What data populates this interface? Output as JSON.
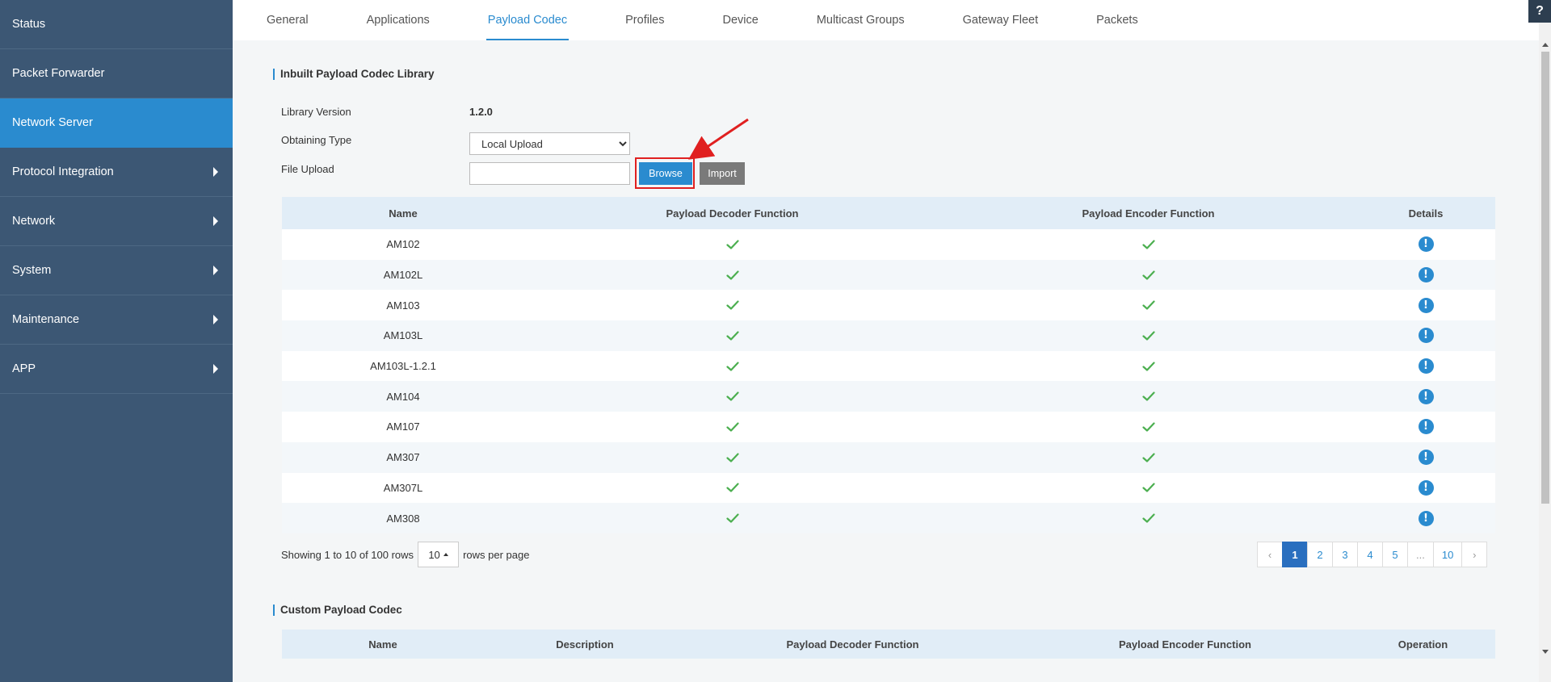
{
  "sidebar": {
    "items": [
      {
        "label": "Status",
        "arrow": false,
        "active": false
      },
      {
        "label": "Packet Forwarder",
        "arrow": false,
        "active": false
      },
      {
        "label": "Network Server",
        "arrow": false,
        "active": true
      },
      {
        "label": "Protocol Integration",
        "arrow": true,
        "active": false
      },
      {
        "label": "Network",
        "arrow": true,
        "active": false
      },
      {
        "label": "System",
        "arrow": true,
        "active": false
      },
      {
        "label": "Maintenance",
        "arrow": true,
        "active": false
      },
      {
        "label": "APP",
        "arrow": true,
        "active": false
      }
    ]
  },
  "tabs": [
    "General",
    "Applications",
    "Payload Codec",
    "Profiles",
    "Device",
    "Multicast Groups",
    "Gateway Fleet",
    "Packets"
  ],
  "active_tab": "Payload Codec",
  "help_label": "?",
  "inbuilt": {
    "title": "Inbuilt Payload Codec Library",
    "library_version_label": "Library Version",
    "library_version": "1.2.0",
    "obtaining_type_label": "Obtaining Type",
    "obtaining_type_value": "Local Upload",
    "file_upload_label": "File Upload",
    "browse_label": "Browse",
    "import_label": "Import"
  },
  "table": {
    "headers": [
      "Name",
      "Payload Decoder Function",
      "Payload Encoder Function",
      "Details"
    ],
    "rows": [
      {
        "name": "AM102",
        "decoder": true,
        "encoder": true
      },
      {
        "name": "AM102L",
        "decoder": true,
        "encoder": true
      },
      {
        "name": "AM103",
        "decoder": true,
        "encoder": true
      },
      {
        "name": "AM103L",
        "decoder": true,
        "encoder": true
      },
      {
        "name": "AM103L-1.2.1",
        "decoder": true,
        "encoder": true
      },
      {
        "name": "AM104",
        "decoder": true,
        "encoder": true
      },
      {
        "name": "AM107",
        "decoder": true,
        "encoder": true
      },
      {
        "name": "AM307",
        "decoder": true,
        "encoder": true
      },
      {
        "name": "AM307L",
        "decoder": true,
        "encoder": true
      },
      {
        "name": "AM308",
        "decoder": true,
        "encoder": true
      }
    ],
    "details_icon": "info-icon"
  },
  "pager": {
    "showing_text": "Showing 1 to 10 of 100 rows",
    "rows_per_page": "10",
    "rows_per_page_suffix": "rows per page",
    "pages": [
      "‹",
      "1",
      "2",
      "3",
      "4",
      "5",
      "...",
      "10",
      "›"
    ],
    "current_page": "1"
  },
  "custom": {
    "title": "Custom Payload Codec",
    "headers": [
      "Name",
      "Description",
      "Payload Decoder Function",
      "Payload Encoder Function",
      "Operation"
    ]
  },
  "colors": {
    "sidebar_bg": "#3c5774",
    "accent": "#2a8bcf",
    "check": "#4caf50",
    "annotation": "#e02020"
  }
}
